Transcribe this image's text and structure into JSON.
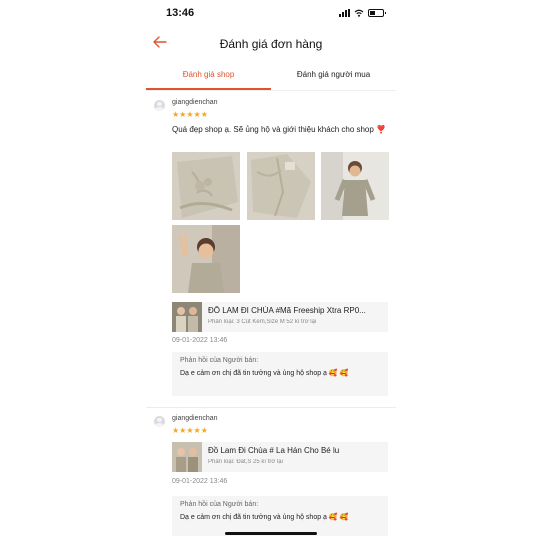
{
  "status_bar": {
    "time": "13:46"
  },
  "header": {
    "title": "Đánh giá đơn hàng",
    "back_icon": "arrow-left-icon"
  },
  "tabs": [
    {
      "label": "Đánh giá shop",
      "active": true
    },
    {
      "label": "Đánh giá người mua",
      "active": false
    }
  ],
  "reviews": [
    {
      "username": "giangdienchan",
      "stars": "★★★★★",
      "rating": 5,
      "comment": "Quá đẹp shop ạ. Sẽ ủng hộ và giới thiệu khách cho shop ❣️",
      "photo_count": 4,
      "product": {
        "name": "ĐỒ LAM ĐI CHÙA #Mã Freeship Xtra RP0...",
        "variant": "Phân loại: 3 Cút Kem,Size M 52 kí trở lại"
      },
      "date": "09-01-2022 13:46",
      "reply": {
        "label": "Phản hồi của Người bán:",
        "text": "Dạ e cảm ơn chị đã tin tưởng và ủng hộ shop ạ 🥰 🥰"
      }
    },
    {
      "username": "giangdienchan",
      "stars": "★★★★★",
      "rating": 5,
      "product": {
        "name": "Đồ Lam Đi Chùa # La Hán Cho Bé lu",
        "variant": "Phân loại: Đất,S 25 kí trở lại"
      },
      "date": "09-01-2022 13:46",
      "reply": {
        "label": "Phản hồi của Người bán:",
        "text": "Dạ e cảm ơn chị đã tin tưởng và ủng hộ shop ạ 🥰 🥰"
      }
    }
  ],
  "colors": {
    "accent": "#e0542d",
    "star": "#f5a623",
    "reply_bg": "#f5f5f5"
  }
}
